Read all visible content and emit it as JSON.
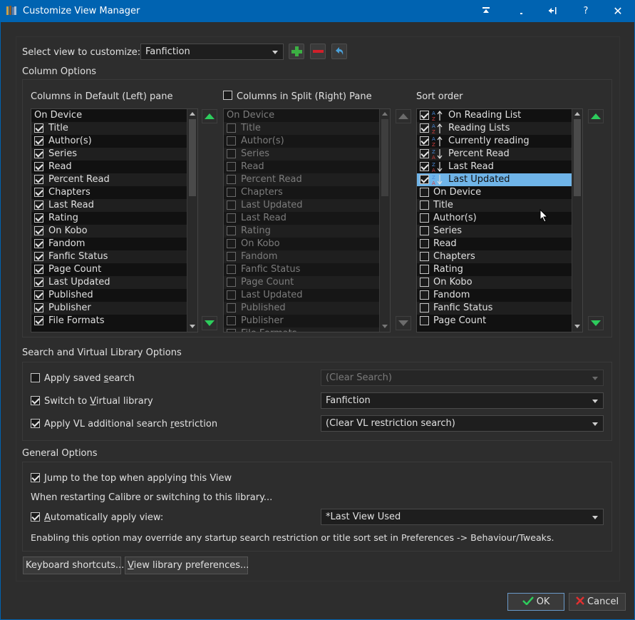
{
  "window": {
    "title": "Customize View Manager",
    "controls": [
      "pin-icon",
      "minimize-icon",
      "restore-icon",
      "help-icon",
      "close-icon"
    ],
    "accent": "#0063b1"
  },
  "view_select": {
    "label": "Select view to customize:",
    "value": "Fanfiction",
    "tools": [
      "add-icon",
      "remove-icon",
      "undo-icon"
    ]
  },
  "column_options": {
    "heading": "Column Options",
    "left": {
      "title": "Columns in Default (Left) pane",
      "items": [
        {
          "label": "On Device",
          "checked": false,
          "header": true
        },
        {
          "label": "Title",
          "checked": true
        },
        {
          "label": "Author(s)",
          "checked": true
        },
        {
          "label": "Series",
          "checked": true
        },
        {
          "label": "Read",
          "checked": true
        },
        {
          "label": "Percent Read",
          "checked": true
        },
        {
          "label": "Chapters",
          "checked": true
        },
        {
          "label": "Last Read",
          "checked": true
        },
        {
          "label": "Rating",
          "checked": true
        },
        {
          "label": "On Kobo",
          "checked": true
        },
        {
          "label": "Fandom",
          "checked": true
        },
        {
          "label": "Fanfic Status",
          "checked": true
        },
        {
          "label": "Page Count",
          "checked": true
        },
        {
          "label": "Last Updated",
          "checked": true
        },
        {
          "label": "Published",
          "checked": true
        },
        {
          "label": "Publisher",
          "checked": true
        },
        {
          "label": "File Formats",
          "checked": true
        }
      ]
    },
    "right": {
      "title": "Columns in Split (Right) Pane",
      "enabled": false,
      "items": [
        {
          "label": "On Device",
          "header": true
        },
        {
          "label": "Title"
        },
        {
          "label": "Author(s)"
        },
        {
          "label": "Series"
        },
        {
          "label": "Read"
        },
        {
          "label": "Percent Read"
        },
        {
          "label": "Chapters"
        },
        {
          "label": "Last Updated"
        },
        {
          "label": "Last Read"
        },
        {
          "label": "Rating"
        },
        {
          "label": "On Kobo"
        },
        {
          "label": "Fandom"
        },
        {
          "label": "Fanfic Status"
        },
        {
          "label": "Page Count"
        },
        {
          "label": "Last Updated"
        },
        {
          "label": "Published"
        },
        {
          "label": "Publisher"
        },
        {
          "label": "File Formats"
        }
      ]
    },
    "sort": {
      "title": "Sort order",
      "items": [
        {
          "label": "On Reading List",
          "checked": true,
          "dir": "asc"
        },
        {
          "label": "Reading Lists",
          "checked": true,
          "dir": "asc"
        },
        {
          "label": "Currently reading",
          "checked": true,
          "dir": "asc"
        },
        {
          "label": "Percent Read",
          "checked": true,
          "dir": "desc"
        },
        {
          "label": "Last Read",
          "checked": true,
          "dir": "desc"
        },
        {
          "label": "Last Updated",
          "checked": true,
          "dir": "desc",
          "selected": true
        },
        {
          "label": "On Device",
          "checked": false
        },
        {
          "label": "Title",
          "checked": false
        },
        {
          "label": "Author(s)",
          "checked": false
        },
        {
          "label": "Series",
          "checked": false
        },
        {
          "label": "Read",
          "checked": false
        },
        {
          "label": "Chapters",
          "checked": false
        },
        {
          "label": "Rating",
          "checked": false
        },
        {
          "label": "On Kobo",
          "checked": false
        },
        {
          "label": "Fandom",
          "checked": false
        },
        {
          "label": "Fanfic Status",
          "checked": false
        },
        {
          "label": "Page Count",
          "checked": false
        }
      ]
    }
  },
  "search_vl": {
    "heading": "Search and Virtual Library Options",
    "apply_saved_search": {
      "pre": "Apply saved ",
      "u": "s",
      "post": "earch",
      "checked": false,
      "combo": "(Clear Search)",
      "combo_enabled": false
    },
    "switch_vl": {
      "pre": "Switch to ",
      "u": "V",
      "post": "irtual library",
      "checked": true,
      "combo": "Fanfiction"
    },
    "apply_vl": {
      "pre": "Apply VL additional search ",
      "u": "r",
      "post": "estriction",
      "checked": true,
      "combo": "(Clear VL restriction search)"
    }
  },
  "general": {
    "heading": "General Options",
    "jump_top": {
      "pre": "",
      "u": "J",
      "post": "ump to the top when applying this View",
      "checked": true
    },
    "restart_note": "When restarting Calibre or switching to this library...",
    "auto_apply": {
      "pre": "",
      "u": "A",
      "post": "utomatically apply view:",
      "checked": true,
      "combo": "*Last View Used"
    },
    "warning": "Enabling this option may override any startup search restriction or title sort set in Preferences -> Behaviour/Tweaks."
  },
  "buttons": {
    "keyboard": "Keyboard shortcuts...",
    "view_prefs_u": "V",
    "view_prefs_rest": "iew library preferences...",
    "ok": "OK",
    "cancel": "Cancel"
  }
}
